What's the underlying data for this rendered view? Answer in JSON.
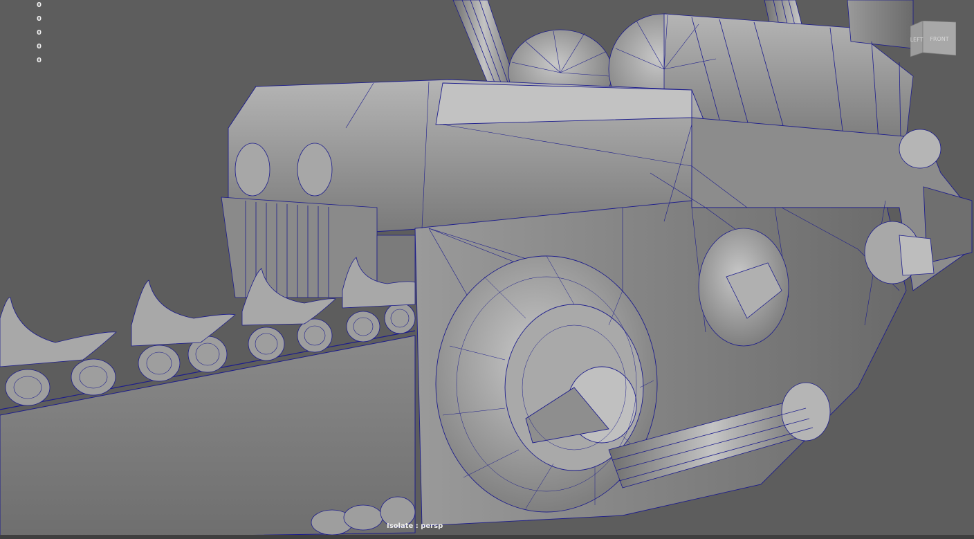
{
  "viewport": {
    "camera_label": "Isolate : persp",
    "hud_stats": [
      "0",
      "0",
      "0",
      "0",
      "0"
    ]
  },
  "viewcube": {
    "left_label": "LEFT",
    "front_label": "FRONT"
  },
  "colors": {
    "background": "#5d5d5d",
    "wireframe": "#1c1c8c",
    "mesh_light": "#b8b8b8",
    "mesh_mid": "#8e8e8e",
    "mesh_dark": "#4a4a4a"
  },
  "icons": [
    "viewcube-icon"
  ]
}
